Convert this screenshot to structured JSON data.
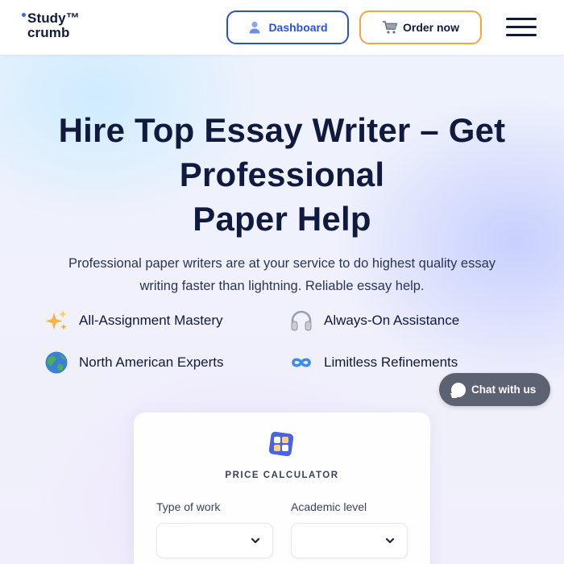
{
  "header": {
    "logo_line1": "Study™",
    "logo_line2": "crumb",
    "dashboard_label": "Dashboard",
    "order_label": "Order now"
  },
  "hero": {
    "title_line1": "Hire Top Essay Writer – Get",
    "title_line2": "Professional",
    "title_line3": "Paper Help",
    "subtitle_line1": "Professional paper writers are at your service to do highest quality essay",
    "subtitle_line2": "writing faster than lightning. Reliable essay help."
  },
  "features": [
    {
      "label": "All-Assignment Mastery",
      "icon": "sparkles-icon"
    },
    {
      "label": "Always-On Assistance",
      "icon": "headphones-icon"
    },
    {
      "label": "North American Experts",
      "icon": "globe-icon"
    },
    {
      "label": "Limitless Refinements",
      "icon": "infinity-icon"
    }
  ],
  "chat": {
    "label": "Chat with us"
  },
  "calculator": {
    "title": "PRICE CALCULATOR",
    "type_label": "Type of work",
    "level_label": "Academic level",
    "type_value": "",
    "level_value": ""
  },
  "colors": {
    "primary": "#2d4fd8",
    "order_border": "#f2a83a",
    "text": "#101a3e",
    "chat_bg": "#5d6272"
  }
}
